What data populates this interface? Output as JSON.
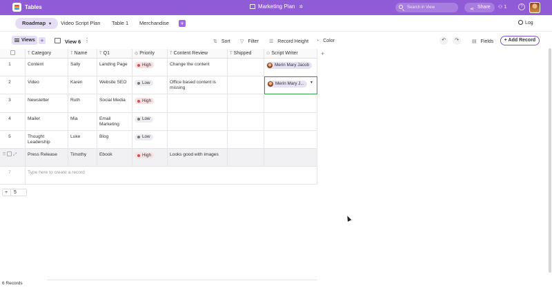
{
  "app": {
    "name": "Tables",
    "document": "Marketing Plan",
    "search_placeholder": "Search in View",
    "share_label": "Share",
    "collaborators": "1"
  },
  "tabs": [
    {
      "label": "Roadmap"
    },
    {
      "label": "Video Script Plan"
    },
    {
      "label": "Table 1"
    },
    {
      "label": "Merchandise"
    }
  ],
  "log_label": "Log",
  "toolbar": {
    "views_label": "Views",
    "view_name": "View 6",
    "sort": "Sort",
    "filter": "Filter",
    "record_height": "Record Height",
    "color": "Color",
    "fields": "Fields",
    "add_record": "+ Add Record"
  },
  "columns": [
    "Category",
    "Name",
    "Q1",
    "Priority",
    "Content Review",
    "Shipped",
    "Script Writer"
  ],
  "rows": [
    {
      "num": "1",
      "category": "Content",
      "name": "Sally",
      "q1": "Landing Page",
      "priority": "High",
      "review": "Change the content",
      "shipped": "",
      "writer": "Merin Mary Jacob"
    },
    {
      "num": "2",
      "category": "Video",
      "name": "Karen",
      "q1": "Website SEO",
      "priority": "Low",
      "review": "Office based content is missing",
      "shipped": "",
      "writer": "Merin Mary J..."
    },
    {
      "num": "3",
      "category": "Newsletter",
      "name": "Ruth",
      "q1": "Social Media",
      "priority": "High",
      "review": "",
      "shipped": "",
      "writer": ""
    },
    {
      "num": "4",
      "category": "Mailer",
      "name": "Mia",
      "q1": "Email Marketing",
      "priority": "Low",
      "review": "",
      "shipped": "",
      "writer": ""
    },
    {
      "num": "5",
      "category": "Thought Leadership",
      "name": "Luke",
      "q1": "Blog",
      "priority": "Low",
      "review": "",
      "shipped": "",
      "writer": ""
    },
    {
      "num": "",
      "category": "Press Release",
      "name": "Timothy",
      "q1": "Ebook",
      "priority": "High",
      "review": "Looks good with images",
      "shipped": "",
      "writer": ""
    }
  ],
  "new_row": {
    "num": "7",
    "placeholder": "Type here to create a record"
  },
  "add_group_count": "5",
  "records_count": "6 Records",
  "colors": {
    "accent": "#8f5bd6",
    "high": "#e04848",
    "selected": "#2fa34b"
  }
}
